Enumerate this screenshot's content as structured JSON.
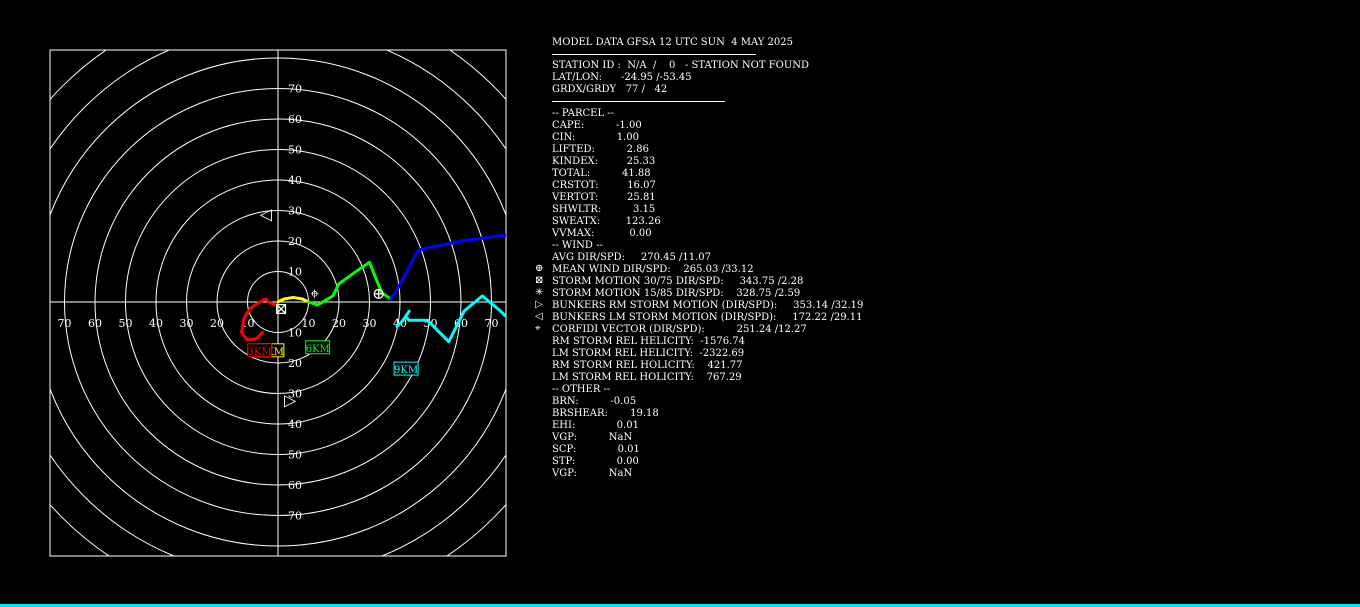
{
  "colors": {
    "background": "#000000",
    "grid": "#ffffff",
    "seg_0_3km": "#ff0000",
    "seg_3_6km": "#ffff00",
    "seg_6_9km": "#00ff00",
    "seg_9_12km": "#0000ff",
    "seg_upper": "#00ffff"
  },
  "header": {
    "title": "MODEL DATA GFSA 12 UTC SUN  4 MAY 2025",
    "station": "STATION ID :  N/A  /    0   - STATION NOT FOUND",
    "latlon": "LAT/LON:      -24.95 /-53.45",
    "grid": "GRDX/GRDY   77 /   42"
  },
  "parcel": {
    "heading": "-- PARCEL --",
    "rows": [
      "CAPE:          -1.00",
      "CIN:             1.00",
      "LIFTED:          2.86",
      "KINDEX:         25.33",
      "TOTAL:          41.88",
      "CRSTOT:         16.07",
      "VERTOT:         25.81",
      "SHWLTR:          3.15",
      "SWEATX:        123.26",
      "VVMAX:           0.00"
    ]
  },
  "wind": {
    "heading": "-- WIND --",
    "rows": [
      {
        "marker": "",
        "text": "AVG DIR/SPD:     270.45 /11.07"
      },
      {
        "marker": "⊕",
        "text": "MEAN WIND DIR/SPD:    265.03 /33.12"
      },
      {
        "marker": "⊠",
        "text": "STORM MOTION 30/75 DIR/SPD:     343.75 /2.28"
      },
      {
        "marker": "✳",
        "text": "STORM MOTION 15/85 DIR/SPD:    328.75 /2.59"
      },
      {
        "marker": "▷",
        "text": "BUNKERS RM STORM MOTION (DIR/SPD):     353.14 /32.19"
      },
      {
        "marker": "◁",
        "text": "BUNKERS LM STORM MOTION (DIR/SPD):     172.22 /29.11"
      },
      {
        "marker": "⌖",
        "text": "CORFIDI VECTOR (DIR/SPD):          251.24 /12.27"
      },
      {
        "marker": "",
        "text": "RM STORM REL HELICITY:  -1576.74"
      },
      {
        "marker": "",
        "text": "LM STORM REL HELICITY:  -2322.69"
      },
      {
        "marker": "",
        "text": "RM STORM REL HOLICITY:    421.77"
      },
      {
        "marker": "",
        "text": "LM STORM REL HOLICITY:    767.29"
      }
    ]
  },
  "other": {
    "heading": "-- OTHER --",
    "rows": [
      "BRN:          -0.05",
      "BRSHEAR:       19.18",
      "EHI:             0.01",
      "VGP:          NaN",
      "SCP:             0.01",
      "STP:             0.00",
      "VGP:          NaN"
    ]
  },
  "chart_data": {
    "type": "scatter",
    "title": "",
    "xlabel": "",
    "ylabel": "",
    "xlim": [
      -75,
      75
    ],
    "ylim": [
      -83,
      83
    ],
    "rings": [
      10,
      20,
      30,
      40,
      50,
      60,
      70,
      80,
      90,
      100
    ],
    "x_tick_labels": [
      "70",
      "60",
      "50",
      "40",
      "30",
      "20",
      "10",
      "10",
      "20",
      "30",
      "40",
      "50",
      "60",
      "70"
    ],
    "x_tick_values": [
      -70,
      -60,
      -50,
      -40,
      -30,
      -20,
      -10,
      10,
      20,
      30,
      40,
      50,
      60,
      70
    ],
    "y_tick_labels": [
      "70",
      "60",
      "50",
      "40",
      "30",
      "20",
      "10",
      "10",
      "20",
      "30",
      "40",
      "50",
      "60",
      "70"
    ],
    "y_tick_values": [
      70,
      60,
      50,
      40,
      30,
      20,
      10,
      -10,
      -20,
      -30,
      -40,
      -50,
      -60,
      -70
    ],
    "grid": true,
    "series": [
      {
        "color": "#ff0000",
        "x": [
          -5,
          -7,
          -10,
          -12,
          -11,
          -9,
          -6,
          -4,
          -3,
          -1,
          0
        ],
        "y": [
          -10,
          -12,
          -12.5,
          -10,
          -5,
          -2,
          0,
          1,
          0,
          -1,
          0
        ]
      },
      {
        "color": "#ffff00",
        "x": [
          0,
          2,
          5,
          8,
          10
        ],
        "y": [
          0,
          1,
          1.5,
          1,
          0
        ]
      },
      {
        "color": "#00ff00",
        "x": [
          10,
          13,
          18,
          20,
          27,
          30,
          34,
          37
        ],
        "y": [
          0,
          -1,
          2,
          6,
          11,
          13,
          3,
          1
        ]
      },
      {
        "color": "#0000ff",
        "x": [
          37,
          39,
          46,
          60,
          75
        ],
        "y": [
          1,
          4,
          17,
          20,
          22
        ]
      },
      {
        "color": "#00ffff",
        "x": [
          75,
          73,
          67,
          61,
          56,
          49,
          43,
          42,
          39,
          41,
          43
        ],
        "y": [
          -5,
          -3,
          2,
          -3,
          -13,
          -6,
          -6,
          -5,
          -8,
          -6,
          -3
        ]
      }
    ],
    "height_labels": [
      {
        "text": "3KM",
        "x": -2,
        "y": -16,
        "color": "#ffff00"
      },
      {
        "text": "3KM",
        "x": -6,
        "y": -16,
        "color": "#ff0000"
      },
      {
        "text": "6KM",
        "x": 13,
        "y": -15,
        "color": "#00ff00"
      },
      {
        "text": "9KM",
        "x": 42,
        "y": -22,
        "color": "#00ffff"
      }
    ],
    "markers": [
      {
        "name": "bunkers-lm-marker",
        "symbol": "◁",
        "x": -4,
        "y": 29
      },
      {
        "name": "bunkers-rm-marker",
        "symbol": "▷",
        "x": 4,
        "y": -32
      },
      {
        "name": "mean-wind-marker",
        "symbol": "⊕",
        "x": 33,
        "y": 3
      },
      {
        "name": "corfidi-marker",
        "symbol": "⌖",
        "x": 12,
        "y": 3
      },
      {
        "name": "storm-motion-marker",
        "symbol": "⊠",
        "x": 1,
        "y": -2
      }
    ]
  }
}
